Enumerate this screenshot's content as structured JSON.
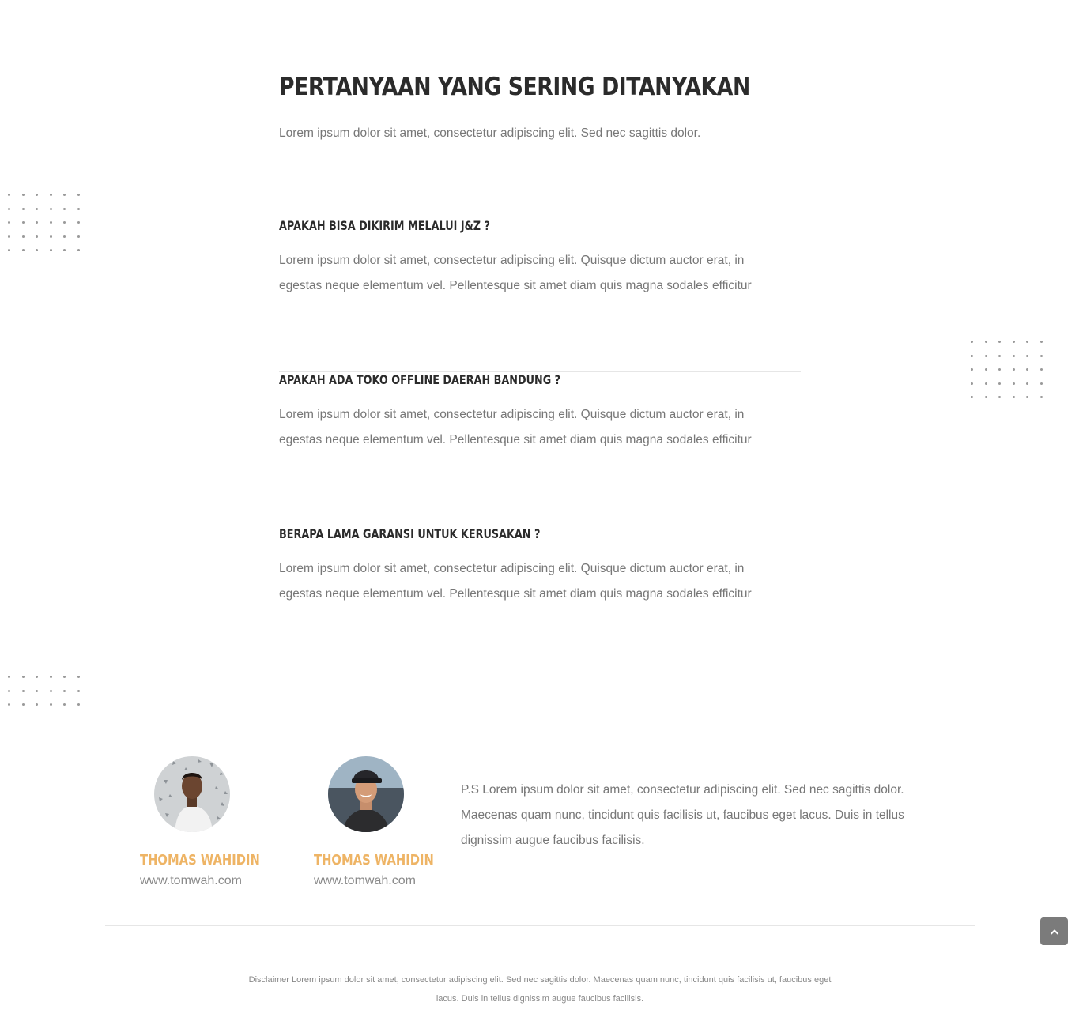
{
  "faq": {
    "title": "PERTANYAAN YANG SERING DITANYAKAN",
    "intro": "Lorem ipsum dolor sit amet, consectetur adipiscing elit. Sed nec sagittis dolor.",
    "items": [
      {
        "question": "APAKAH BISA DIKIRIM MELALUI J&Z ?",
        "answer": "Lorem ipsum dolor sit amet, consectetur adipiscing elit. Quisque dictum auctor erat, in egestas neque elementum vel. Pellentesque sit amet diam quis magna sodales efficitur"
      },
      {
        "question": "APAKAH ADA TOKO OFFLINE DAERAH BANDUNG ?",
        "answer": "Lorem ipsum dolor sit amet, consectetur adipiscing elit. Quisque dictum auctor erat, in egestas neque elementum vel. Pellentesque sit amet diam quis magna sodales efficitur"
      },
      {
        "question": "BERAPA LAMA GARANSI UNTUK KERUSAKAN ?",
        "answer": "Lorem ipsum dolor sit amet, consectetur adipiscing elit. Quisque dictum auctor erat, in egestas neque elementum vel. Pellentesque sit amet diam quis magna sodales efficitur"
      }
    ]
  },
  "people": [
    {
      "name": "THOMAS WAHIDIN",
      "site": "www.tomwah.com"
    },
    {
      "name": "THOMAS WAHIDIN",
      "site": "www.tomwah.com"
    }
  ],
  "ps_text": "P.S Lorem ipsum dolor sit amet, consectetur adipiscing elit. Sed nec sagittis dolor. Maecenas quam nunc, tincidunt quis facilisis ut, faucibus eget lacus. Duis in tellus dignissim augue faucibus facilisis.",
  "disclaimer": "Disclaimer Lorem ipsum dolor sit amet, consectetur adipiscing elit. Sed nec sagittis dolor. Maecenas quam nunc, tincidunt quis facilisis ut, faucibus eget lacus. Duis in tellus dignissim augue faucibus facilisis.",
  "colors": {
    "accent": "#eeb465",
    "heading": "#2b2b2b",
    "body_text": "#777777",
    "back_to_top": "#7b7b7b"
  },
  "icons": {
    "back_to_top": "chevron-up-icon"
  }
}
